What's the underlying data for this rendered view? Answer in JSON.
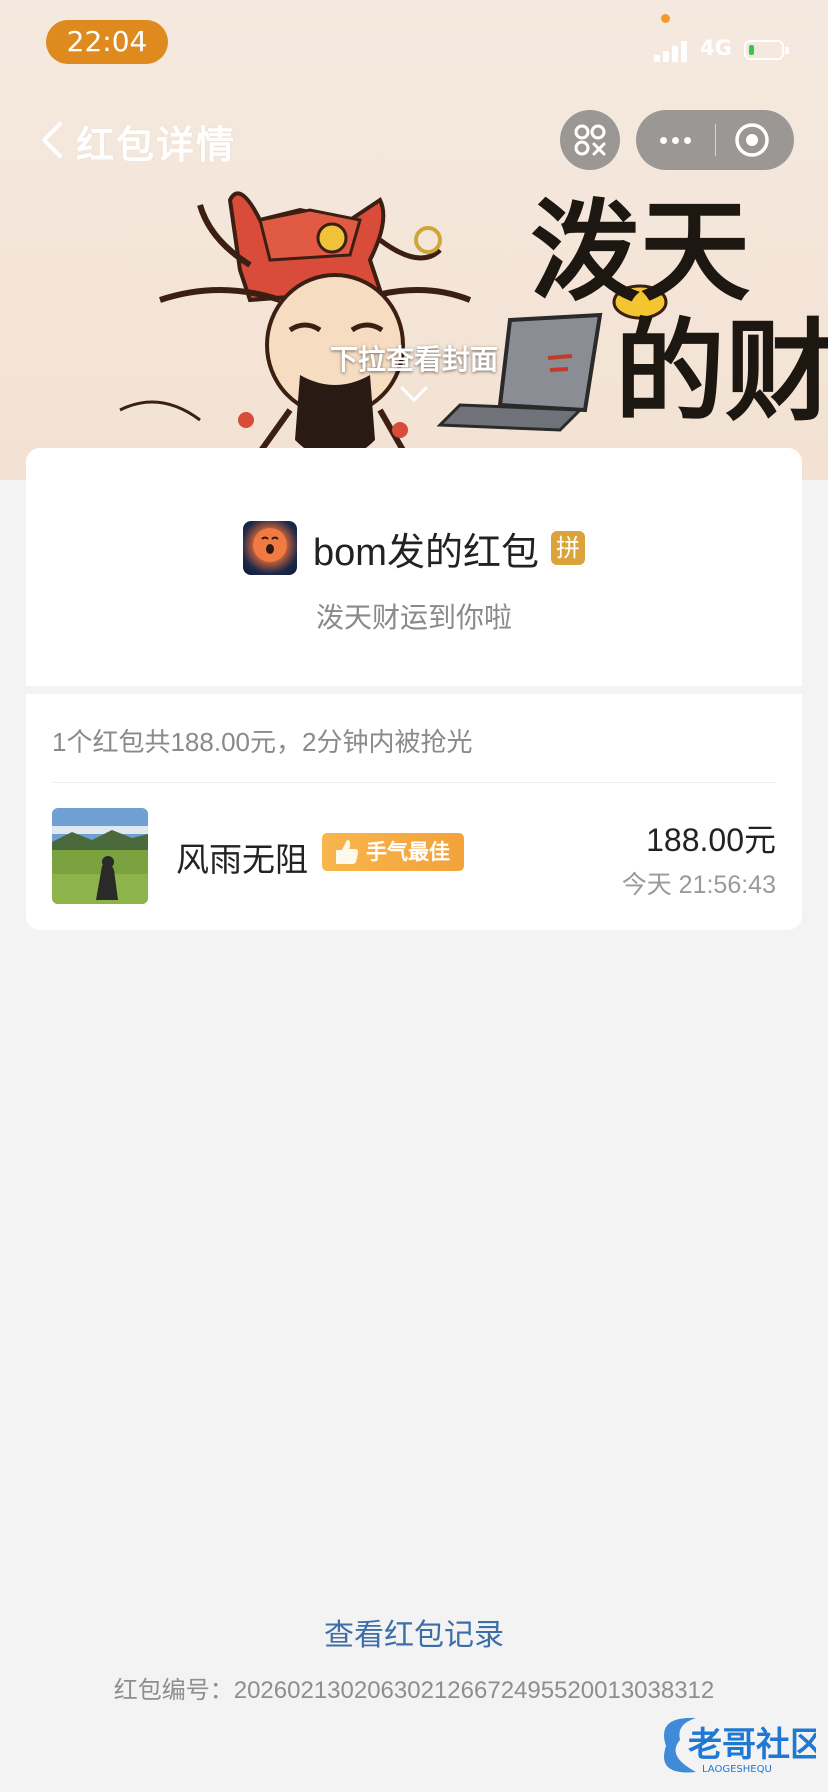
{
  "status_bar": {
    "time": "22:04",
    "network": "4G",
    "battery_level_fraction": 0.15
  },
  "nav": {
    "title": "红包详情",
    "scan_icon": "scan-icon",
    "more_icon": "more-icon",
    "close_icon": "record-target-icon"
  },
  "cover": {
    "pull_hint": "下拉查看封面",
    "cover_text": [
      "泼天",
      "的财"
    ]
  },
  "packet": {
    "sender_title": "bom发的红包",
    "type_badge": "拼",
    "blessing": "泼天财运到你啦",
    "summary": "1个红包共188.00元，2分钟内被抢光"
  },
  "receivers": [
    {
      "name": "风雨无阻",
      "badge": "手气最佳",
      "amount": "188.00",
      "currency": "元",
      "time": "今天 21:56:43"
    }
  ],
  "footer": {
    "record_link": "查看红包记录",
    "serial_label": "红包编号：",
    "serial_number": "20260213020630212667249552001303831​2"
  },
  "watermark": {
    "text": "老哥社区",
    "subtext": "LAOGESHEQU"
  },
  "colors": {
    "accent_orange": "#de8a1e",
    "link_blue": "#3d6ea8",
    "badge_gold": "#dba33c",
    "best_badge": "#f5ab41"
  }
}
